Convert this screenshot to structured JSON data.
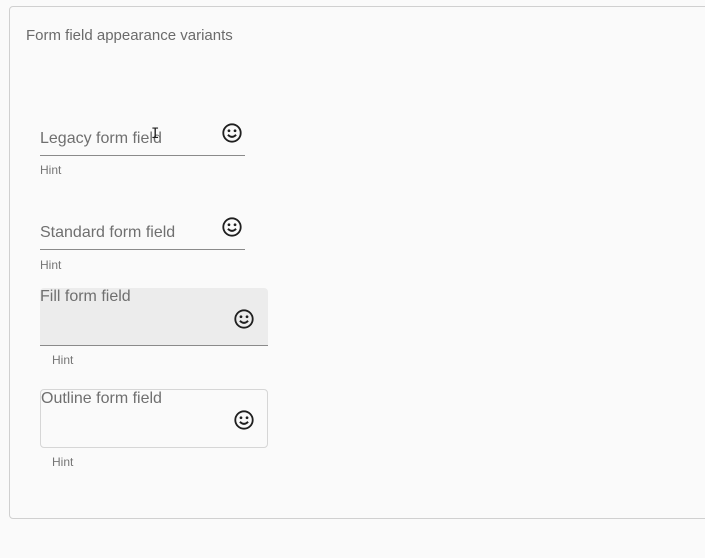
{
  "card": {
    "title": "Form field appearance variants"
  },
  "fields": {
    "legacy": {
      "label": "Legacy form field",
      "hint": "Hint",
      "icon": "sentiment-satisfied-icon"
    },
    "standard": {
      "label": "Standard form field",
      "hint": "Hint",
      "icon": "sentiment-satisfied-icon"
    },
    "fill": {
      "label": "Fill form field",
      "hint": "Hint",
      "icon": "sentiment-satisfied-icon"
    },
    "outline": {
      "label": "Outline form field",
      "hint": "Hint",
      "icon": "sentiment-satisfied-icon"
    }
  },
  "colors": {
    "background": "#fafafa",
    "label": "#6f6f6f",
    "fill_bg": "#ececec",
    "icon": "#1f1f1f"
  }
}
